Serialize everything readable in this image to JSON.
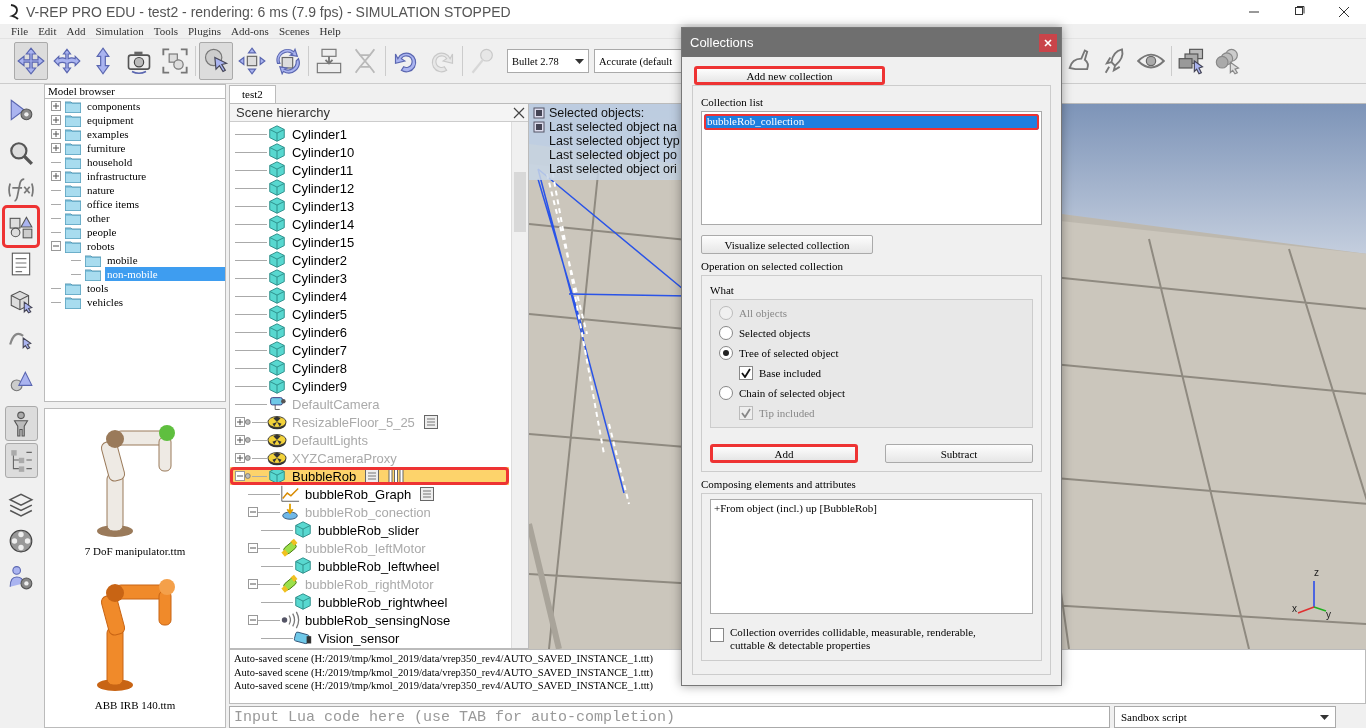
{
  "window": {
    "title": "V-REP PRO EDU - test2 - rendering: 6 ms (7.9 fps) - SIMULATION STOPPED"
  },
  "menu": [
    "File",
    "Edit",
    "Add",
    "Simulation",
    "Tools",
    "Plugins",
    "Add-ons",
    "Scenes",
    "Help"
  ],
  "toolbar": {
    "left_groups": [
      [
        {
          "kind": "pan",
          "pressed": true,
          "disabled": false
        },
        {
          "kind": "rotate",
          "pressed": false,
          "disabled": false
        },
        {
          "kind": "zoom",
          "pressed": false,
          "disabled": false
        },
        {
          "kind": "camera",
          "pressed": false,
          "disabled": false
        },
        {
          "kind": "fit",
          "pressed": false,
          "disabled": false
        }
      ],
      [
        {
          "kind": "select",
          "pressed": true,
          "disabled": false
        },
        {
          "kind": "shift",
          "pressed": false,
          "disabled": false
        },
        {
          "kind": "orient",
          "pressed": false,
          "disabled": false
        }
      ],
      [
        {
          "kind": "assemble",
          "pressed": false,
          "disabled": false
        },
        {
          "kind": "transfer",
          "pressed": false,
          "disabled": true
        }
      ],
      [
        {
          "kind": "undo",
          "pressed": false,
          "disabled": false
        },
        {
          "kind": "redo",
          "pressed": false,
          "disabled": true
        }
      ],
      [
        {
          "kind": "pin",
          "pressed": false,
          "disabled": true
        }
      ]
    ],
    "dropdowns": [
      "Bullet 2.78",
      "Accurate (default"
    ],
    "right_groups": [
      [
        {
          "kind": "rabbit",
          "pressed": false,
          "disabled": false
        },
        {
          "kind": "rocket",
          "pressed": false,
          "disabled": false
        },
        {
          "kind": "eye",
          "pressed": false,
          "disabled": false
        }
      ],
      [
        {
          "kind": "windows",
          "pressed": false,
          "disabled": false
        },
        {
          "kind": "spheres",
          "pressed": false,
          "disabled": false
        }
      ]
    ]
  },
  "side_toolbar": {
    "groups": [
      [
        {
          "kind": "script",
          "pressed": false,
          "highlighted": false
        }
      ],
      [
        {
          "kind": "search",
          "pressed": false,
          "highlighted": false
        },
        {
          "kind": "function",
          "pressed": false,
          "highlighted": false
        },
        {
          "kind": "collections",
          "pressed": false,
          "highlighted": true
        },
        {
          "kind": "document",
          "pressed": false,
          "highlighted": false
        },
        {
          "kind": "cube",
          "pressed": false,
          "highlighted": false
        },
        {
          "kind": "path",
          "pressed": false,
          "highlighted": false
        }
      ],
      [
        {
          "kind": "shapes",
          "pressed": false,
          "highlighted": false
        }
      ],
      [
        {
          "kind": "figure",
          "pressed": true,
          "highlighted": false
        },
        {
          "kind": "list",
          "pressed": true,
          "highlighted": false
        }
      ],
      [
        {
          "kind": "layers",
          "pressed": false,
          "highlighted": false
        },
        {
          "kind": "film",
          "pressed": false,
          "highlighted": false
        },
        {
          "kind": "person",
          "pressed": false,
          "highlighted": false
        }
      ]
    ]
  },
  "model_browser": {
    "title": "Model browser",
    "items": [
      {
        "label": "components",
        "expanded": false,
        "selected": false
      },
      {
        "label": "equipment",
        "expanded": false,
        "selected": false
      },
      {
        "label": "examples",
        "expanded": false,
        "selected": false
      },
      {
        "label": "furniture",
        "expanded": false,
        "selected": false
      },
      {
        "label": "household",
        "selected": false
      },
      {
        "label": "infrastructure",
        "expanded": false,
        "selected": false
      },
      {
        "label": "nature",
        "selected": false
      },
      {
        "label": "office items",
        "selected": false
      },
      {
        "label": "other",
        "selected": false
      },
      {
        "label": "people",
        "selected": false
      },
      {
        "label": "robots",
        "expanded": true,
        "selected": false,
        "children": [
          {
            "label": "mobile",
            "selected": false
          },
          {
            "label": "non-mobile",
            "selected": true
          }
        ]
      },
      {
        "label": "tools",
        "selected": false
      },
      {
        "label": "vehicles",
        "selected": false
      }
    ],
    "thumbnails": [
      {
        "label": "7 DoF manipulator.ttm",
        "kind": "picture"
      },
      {
        "label": "ABB IRB 140.ttm",
        "kind": "picture"
      }
    ]
  },
  "tabs": [
    {
      "label": "test2",
      "selected": true
    }
  ],
  "scene_hierarchy": {
    "title": "Scene hierarchy",
    "items": [
      {
        "label": "Cylinder1",
        "kind": "shape",
        "dimmed": false,
        "selected": false,
        "highlighted": false
      },
      {
        "label": "Cylinder10",
        "kind": "shape",
        "dimmed": false,
        "selected": false,
        "highlighted": false
      },
      {
        "label": "Cylinder11",
        "kind": "shape",
        "dimmed": false,
        "selected": false,
        "highlighted": false
      },
      {
        "label": "Cylinder12",
        "kind": "shape",
        "dimmed": false,
        "selected": false,
        "highlighted": false
      },
      {
        "label": "Cylinder13",
        "kind": "shape",
        "dimmed": false,
        "selected": false,
        "highlighted": false
      },
      {
        "label": "Cylinder14",
        "kind": "shape",
        "dimmed": false,
        "selected": false,
        "highlighted": false
      },
      {
        "label": "Cylinder15",
        "kind": "shape",
        "dimmed": false,
        "selected": false,
        "highlighted": false
      },
      {
        "label": "Cylinder2",
        "kind": "shape",
        "dimmed": false,
        "selected": false,
        "highlighted": false
      },
      {
        "label": "Cylinder3",
        "kind": "shape",
        "dimmed": false,
        "selected": false,
        "highlighted": false
      },
      {
        "label": "Cylinder4",
        "kind": "shape",
        "dimmed": false,
        "selected": false,
        "highlighted": false
      },
      {
        "label": "Cylinder5",
        "kind": "shape",
        "dimmed": false,
        "selected": false,
        "highlighted": false
      },
      {
        "label": "Cylinder6",
        "kind": "shape",
        "dimmed": false,
        "selected": false,
        "highlighted": false
      },
      {
        "label": "Cylinder7",
        "kind": "shape",
        "dimmed": false,
        "selected": false,
        "highlighted": false
      },
      {
        "label": "Cylinder8",
        "kind": "shape",
        "dimmed": false,
        "selected": false,
        "highlighted": false
      },
      {
        "label": "Cylinder9",
        "kind": "shape",
        "dimmed": false,
        "selected": false,
        "highlighted": false
      },
      {
        "label": "DefaultCamera",
        "kind": "camera",
        "dimmed": true,
        "selected": false,
        "highlighted": false
      },
      {
        "label": "ResizableFloor_5_25",
        "kind": "disc",
        "model": true,
        "expanded": false,
        "script": true,
        "dimmed": true,
        "selected": false,
        "highlighted": false
      },
      {
        "label": "DefaultLights",
        "kind": "disc",
        "model": true,
        "expanded": false,
        "dimmed": true,
        "selected": false,
        "highlighted": false
      },
      {
        "label": "XYZCameraProxy",
        "kind": "disc",
        "model": true,
        "expanded": false,
        "dimmed": true,
        "selected": false,
        "highlighted": false
      },
      {
        "label": "BubbleRob",
        "kind": "shape",
        "model": true,
        "expanded": true,
        "script": true,
        "customization": true,
        "dimmed": false,
        "selected": true,
        "highlighted": true,
        "children": [
          {
            "label": "bubbleRob_Graph",
            "kind": "graph",
            "script": true,
            "dimmed": false,
            "selected": false,
            "highlighted": false
          },
          {
            "label": "bubbleRob_conection",
            "kind": "force",
            "expanded": true,
            "dimmed": true,
            "selected": false,
            "highlighted": false,
            "children": [
              {
                "label": "bubbleRob_slider",
                "kind": "shape",
                "dimmed": false,
                "selected": false,
                "highlighted": false
              }
            ]
          },
          {
            "label": "bubbleRob_leftMotor",
            "kind": "joint",
            "expanded": true,
            "dimmed": true,
            "selected": false,
            "highlighted": false,
            "children": [
              {
                "label": "bubbleRob_leftwheel",
                "kind": "shape",
                "dimmed": false,
                "selected": false,
                "highlighted": false
              }
            ]
          },
          {
            "label": "bubbleRob_rightMotor",
            "kind": "joint",
            "expanded": true,
            "dimmed": true,
            "selected": false,
            "highlighted": false,
            "children": [
              {
                "label": "bubbleRob_rightwheel",
                "kind": "shape",
                "dimmed": false,
                "selected": false,
                "highlighted": false
              }
            ]
          },
          {
            "label": "bubbleRob_sensingNose",
            "kind": "proximity",
            "expanded": true,
            "dimmed": false,
            "selected": false,
            "highlighted": false,
            "children": [
              {
                "label": "Vision_sensor",
                "kind": "vision",
                "dimmed": false,
                "selected": false,
                "highlighted": false
              }
            ]
          }
        ]
      }
    ]
  },
  "viewport": {
    "info_lines": [
      "Selected objects:",
      "Last selected object na",
      "Last selected object typ",
      "Last selected object po",
      "Last selected object ori"
    ],
    "axes": [
      "z",
      "x",
      "y"
    ]
  },
  "console": {
    "lines": [
      "Auto-saved scene (H:/2019/tmp/kmol_2019/data/vrep350_rev4/AUTO_SAVED_INSTANCE_1.ttt)",
      "Auto-saved scene (H:/2019/tmp/kmol_2019/data/vrep350_rev4/AUTO_SAVED_INSTANCE_1.ttt)",
      "Auto-saved scene (H:/2019/tmp/kmol_2019/data/vrep350_rev4/AUTO_SAVED_INSTANCE_1.ttt)"
    ],
    "input": {
      "placeholder": "Input Lua code here (use TAB for auto-completion)"
    },
    "script_select": "Sandbox script"
  },
  "dialog": {
    "title": "Collections",
    "add_new_button": {
      "label": "Add new collection",
      "highlighted": true
    },
    "collection_list_label": "Collection list",
    "collections": [
      {
        "label": "bubbleRob_collection",
        "selected": true,
        "highlighted": true
      }
    ],
    "visualize_button": {
      "label": "Visualize selected collection",
      "highlighted": false
    },
    "operation_label": "Operation on selected collection",
    "what_label": "What",
    "options": [
      {
        "kind": "radio",
        "label": "All objects",
        "selected": false,
        "disabled": true
      },
      {
        "kind": "radio",
        "label": "Selected objects",
        "selected": false,
        "disabled": false
      },
      {
        "kind": "radio",
        "label": "Tree of selected object",
        "selected": true,
        "disabled": false
      },
      {
        "kind": "checkbox",
        "label": "Base included",
        "checked": true,
        "disabled": false
      },
      {
        "kind": "radio",
        "label": "Chain of selected object",
        "selected": false,
        "disabled": false
      },
      {
        "kind": "checkbox",
        "label": "Tip included",
        "checked": true,
        "disabled": true
      }
    ],
    "buttons": [
      {
        "label": "Add",
        "highlighted": true
      },
      {
        "label": "Subtract",
        "highlighted": false
      }
    ],
    "composing_label": "Composing elements and attributes",
    "composing_items": [
      "+From object (incl.) up [BubbleRob]"
    ],
    "override": {
      "label": "Collection overrides collidable, measurable, renderable, cuttable & detectable properties",
      "checked": false
    }
  }
}
